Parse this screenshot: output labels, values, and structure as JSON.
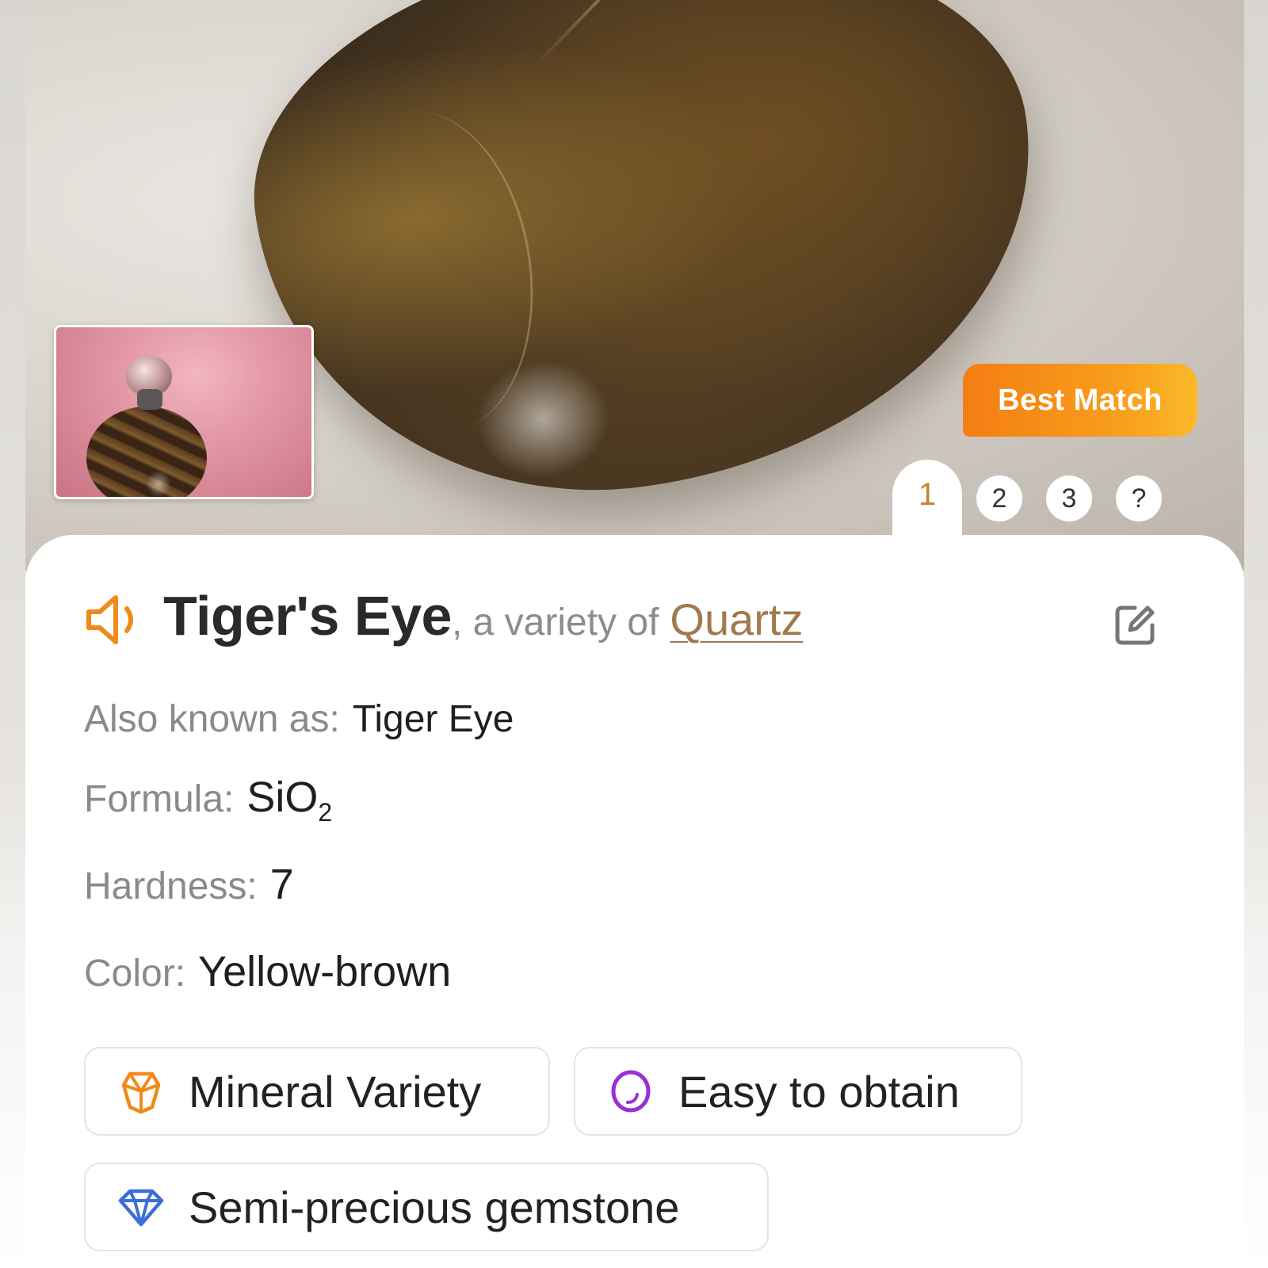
{
  "result": {
    "badge": "Best Match",
    "tabs": [
      "1",
      "2",
      "3",
      "?"
    ],
    "active_tab": "1"
  },
  "mineral": {
    "name": "Tiger's Eye",
    "variety_prefix": ", a variety of",
    "variety_of": "Quartz"
  },
  "fields": {
    "aka_label": "Also known as:",
    "aka_value": "Tiger Eye",
    "formula_label": "Formula:",
    "formula_base": "SiO",
    "formula_sub": "2",
    "hardness_label": "Hardness:",
    "hardness_value": "7",
    "color_label": "Color:",
    "color_value": "Yellow-brown"
  },
  "chips": [
    {
      "label": "Mineral Variety",
      "icon": "crystal-icon",
      "color": "#f08a1c"
    },
    {
      "label": "Easy to obtain",
      "icon": "easy-icon",
      "color": "#9b2fd6"
    },
    {
      "label": "Semi-precious gemstone",
      "icon": "gem-icon",
      "color": "#3a6fd8"
    }
  ],
  "colors": {
    "accent_orange": "#f57d12",
    "link_brown": "#a07a4c",
    "tab_active": "#c3862a"
  }
}
